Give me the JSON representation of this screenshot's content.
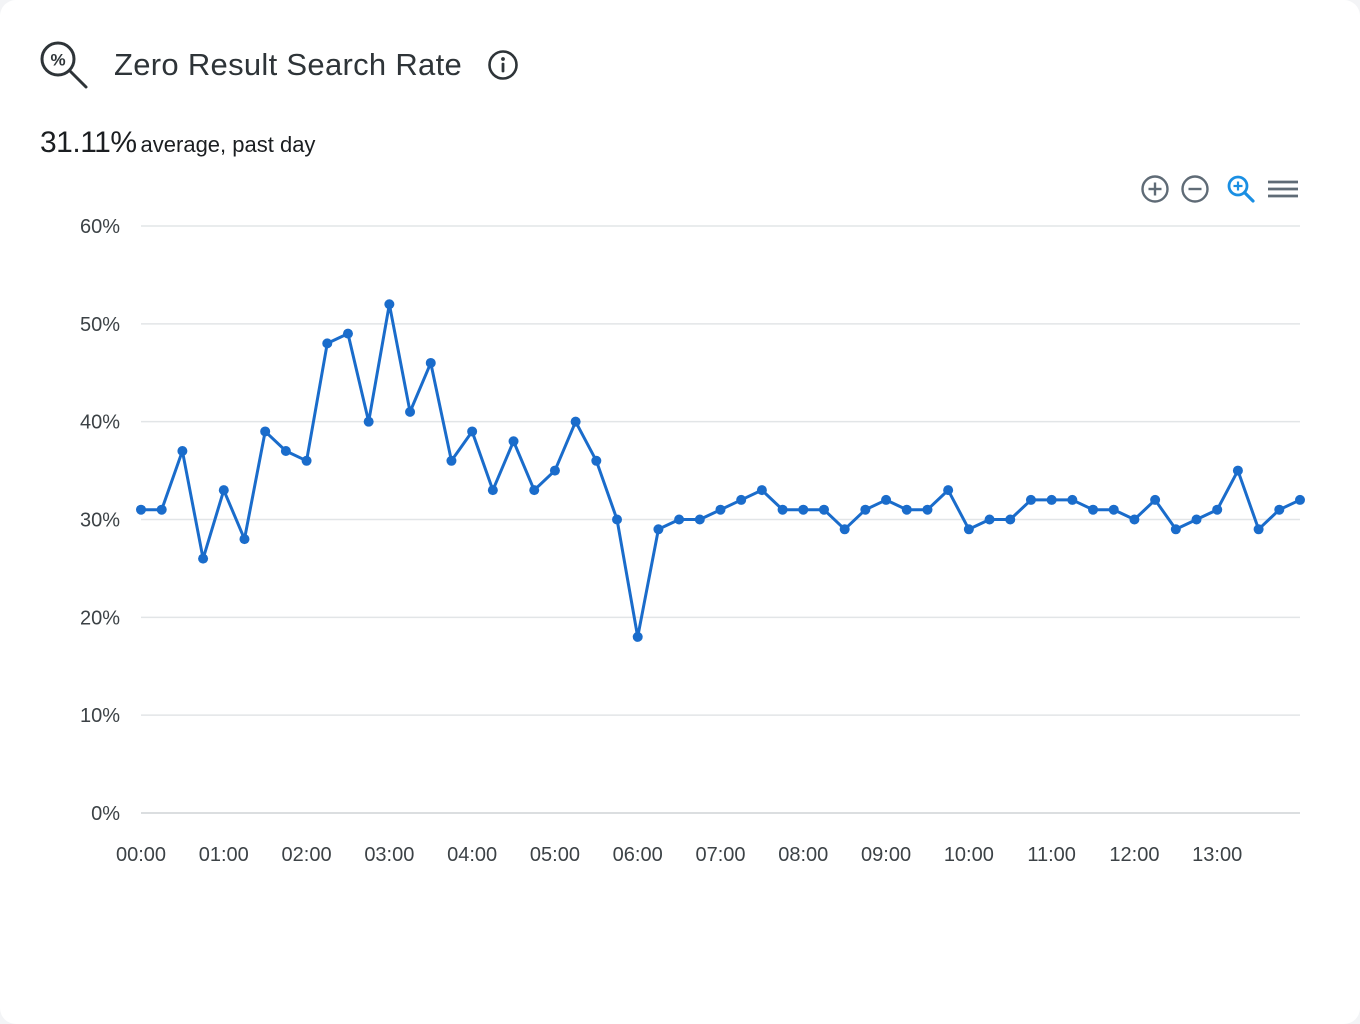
{
  "header": {
    "icon": "search-percent-icon",
    "title": "Zero Result Search Rate",
    "info_icon": "info-icon"
  },
  "summary": {
    "value": "31.11%",
    "caption": "average, past day"
  },
  "toolbar": {
    "icons": [
      "zoom-in-icon",
      "zoom-out-icon",
      "selection-zoom-icon",
      "menu-icon"
    ],
    "active_color": "#1a8fe3",
    "inactive_color": "#5f6b76"
  },
  "chart_data": {
    "type": "line",
    "title": "",
    "xlabel": "",
    "ylabel": "",
    "ylim": [
      0,
      60
    ],
    "y_ticks": [
      "0%",
      "10%",
      "20%",
      "30%",
      "40%",
      "50%",
      "60%"
    ],
    "x_ticks": [
      "00:00",
      "01:00",
      "02:00",
      "03:00",
      "04:00",
      "05:00",
      "06:00",
      "07:00",
      "08:00",
      "09:00",
      "10:00",
      "11:00",
      "12:00",
      "13:00"
    ],
    "grid": true,
    "color": "#1a6ccb",
    "series": [
      {
        "values": [
          31,
          31,
          37,
          26,
          33,
          28,
          39,
          37,
          36,
          48,
          49,
          40,
          52,
          41,
          46,
          36,
          39,
          33,
          38,
          33,
          35,
          40,
          36,
          30,
          18,
          29,
          30,
          30,
          31,
          32,
          33,
          31,
          31,
          31,
          29,
          31,
          32,
          31,
          31,
          33,
          29,
          30,
          30,
          32,
          32,
          32,
          31,
          31,
          30,
          32,
          29,
          30,
          31,
          35,
          29,
          31,
          32
        ]
      }
    ]
  }
}
